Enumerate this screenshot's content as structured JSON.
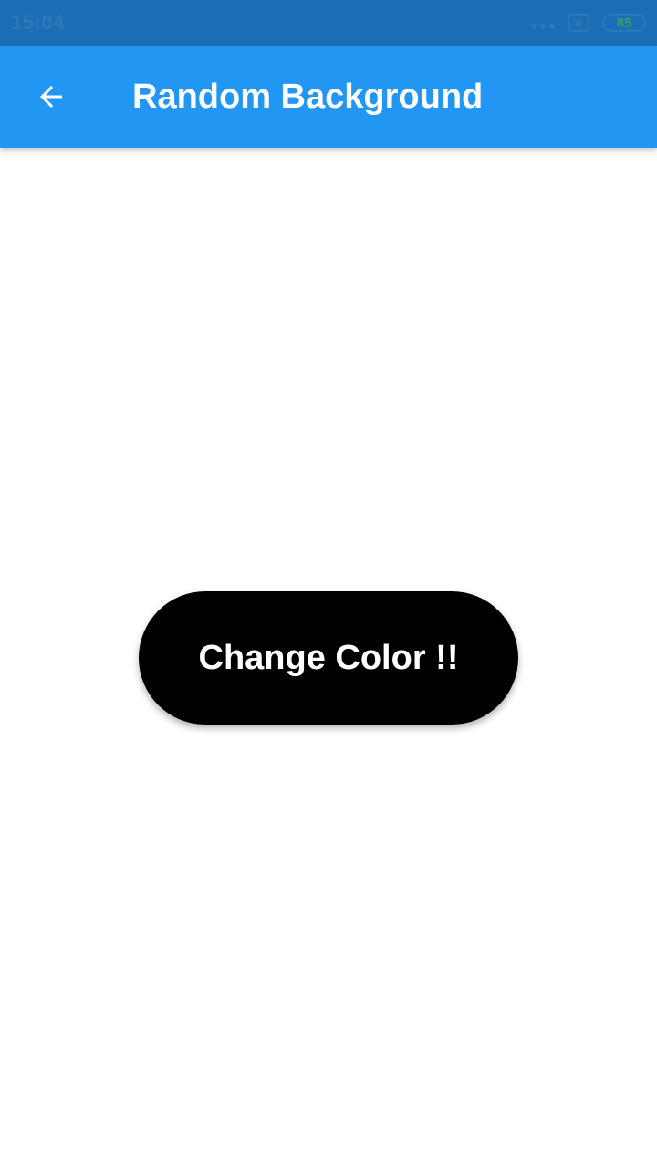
{
  "status_bar": {
    "time": "15:04",
    "battery_level": "85",
    "icons": [
      "more-dots-icon",
      "sim-icon",
      "battery-icon"
    ],
    "background_color": "#1c6fb7"
  },
  "app_bar": {
    "title": "Random Background",
    "back_icon": "arrow-back-icon",
    "background_color": "#2196f3"
  },
  "main": {
    "button_label": "Change Color !!",
    "button_color": "#000000",
    "background_color": "#ffffff"
  }
}
